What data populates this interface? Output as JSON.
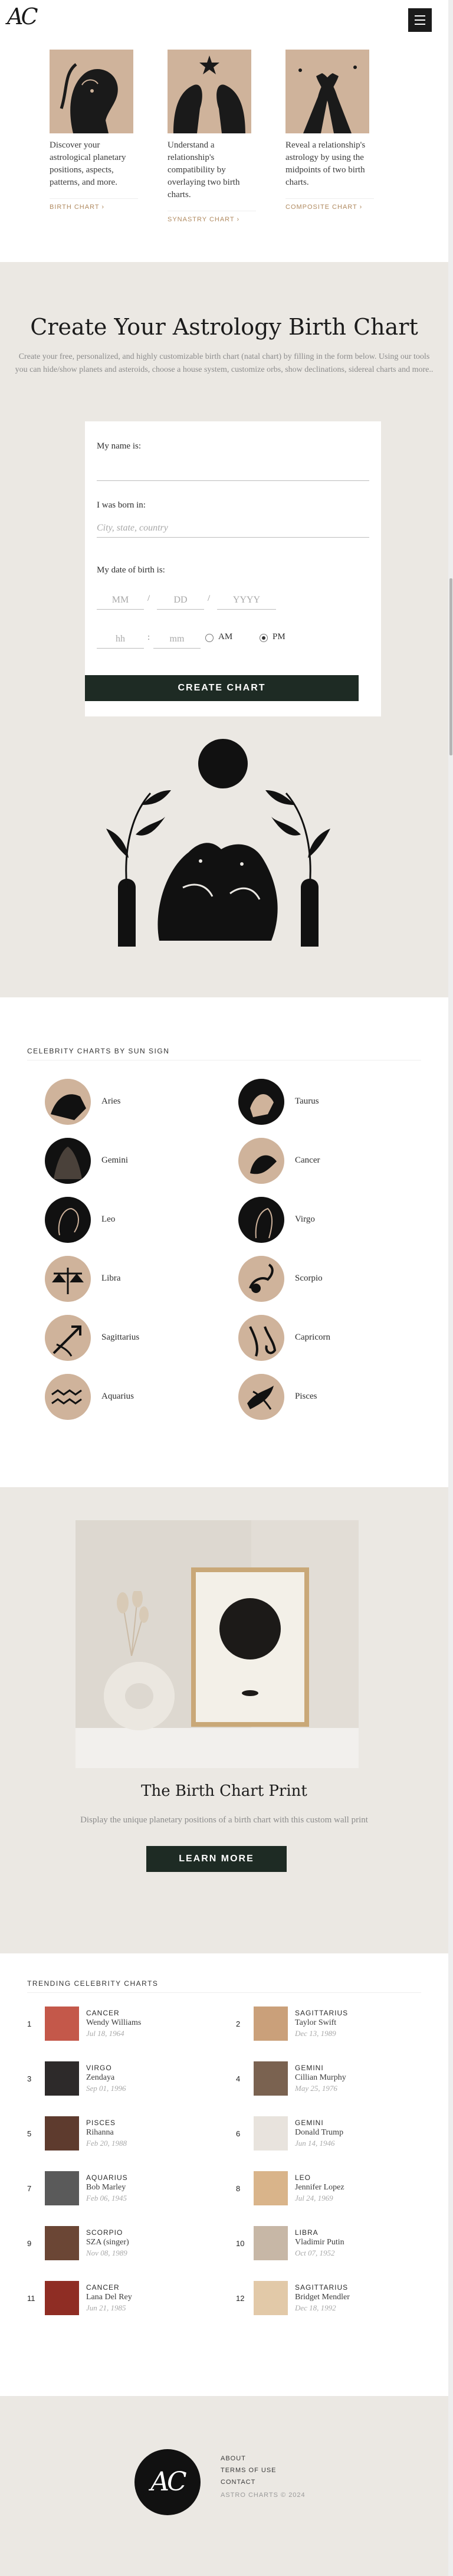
{
  "header": {
    "logo": "AC",
    "menu_icon": "hamburger-icon"
  },
  "feature_cards": [
    {
      "desc": "Discover your astrological planetary positions, aspects, patterns, and more.",
      "link": "BIRTH CHART"
    },
    {
      "desc": "Understand a relationship's compatibility by overlaying two birth charts.",
      "link": "SYNASTRY CHART"
    },
    {
      "desc": "Reveal a relationship's astrology by using the midpoints of two birth charts.",
      "link": "COMPOSITE CHART"
    }
  ],
  "create": {
    "title": "Create Your Astrology Birth Chart",
    "description": "Create your free, personalized, and highly customizable birth chart (natal chart) by filling in the form below. Using our tools you can hide/show planets and asteroids, choose a house system, customize orbs, show declinations, sidereal charts and more..",
    "form": {
      "name_label": "My name is:",
      "born_label": "I was born in:",
      "city_placeholder": "City, state, country",
      "date_label": "My date of birth is:",
      "mm": "MM",
      "dd": "DD",
      "yyyy": "YYYY",
      "hh": "hh",
      "min": "mm",
      "am": "AM",
      "pm": "PM",
      "selected": "PM",
      "submit": "CREATE CHART"
    }
  },
  "celebrity_signs": {
    "title": "CELEBRITY CHARTS BY SUN SIGN",
    "signs": [
      "Aries",
      "Taurus",
      "Gemini",
      "Cancer",
      "Leo",
      "Virgo",
      "Libra",
      "Scorpio",
      "Sagittarius",
      "Capricorn",
      "Aquarius",
      "Pisces"
    ]
  },
  "print": {
    "title": "The Birth Chart Print",
    "description": "Display the unique planetary positions of a birth chart with this custom wall print",
    "button": "LEARN MORE"
  },
  "trending": {
    "title": "TRENDING CELEBRITY CHARTS",
    "items": [
      {
        "rank": "1",
        "sign": "CANCER",
        "name": "Wendy Williams",
        "date": "Jul 18, 1964"
      },
      {
        "rank": "2",
        "sign": "SAGITTARIUS",
        "name": "Taylor Swift",
        "date": "Dec 13, 1989"
      },
      {
        "rank": "3",
        "sign": "VIRGO",
        "name": "Zendaya",
        "date": "Sep 01, 1996"
      },
      {
        "rank": "4",
        "sign": "GEMINI",
        "name": "Cillian Murphy",
        "date": "May 25, 1976"
      },
      {
        "rank": "5",
        "sign": "PISCES",
        "name": "Rihanna",
        "date": "Feb 20, 1988"
      },
      {
        "rank": "6",
        "sign": "GEMINI",
        "name": "Donald Trump",
        "date": "Jun 14, 1946"
      },
      {
        "rank": "7",
        "sign": "AQUARIUS",
        "name": "Bob Marley",
        "date": "Feb 06, 1945"
      },
      {
        "rank": "8",
        "sign": "LEO",
        "name": "Jennifer Lopez",
        "date": "Jul 24, 1969"
      },
      {
        "rank": "9",
        "sign": "SCORPIO",
        "name": "SZA (singer)",
        "date": "Nov 08, 1989"
      },
      {
        "rank": "10",
        "sign": "LIBRA",
        "name": "Vladimir Putin",
        "date": "Oct 07, 1952"
      },
      {
        "rank": "11",
        "sign": "CANCER",
        "name": "Lana Del Rey",
        "date": "Jun 21, 1985"
      },
      {
        "rank": "12",
        "sign": "SAGITTARIUS",
        "name": "Bridget Mendler",
        "date": "Dec 18, 1992"
      }
    ]
  },
  "footer": {
    "logo": "AC",
    "links": [
      "ABOUT",
      "TERMS OF USE",
      "CONTACT"
    ],
    "copyright": "ASTRO CHARTS © 2024"
  },
  "colors": {
    "accent": "#b08a60",
    "tan": "#cfb39b",
    "button": "#1e2b24",
    "section_bg": "#ebe8e3"
  }
}
